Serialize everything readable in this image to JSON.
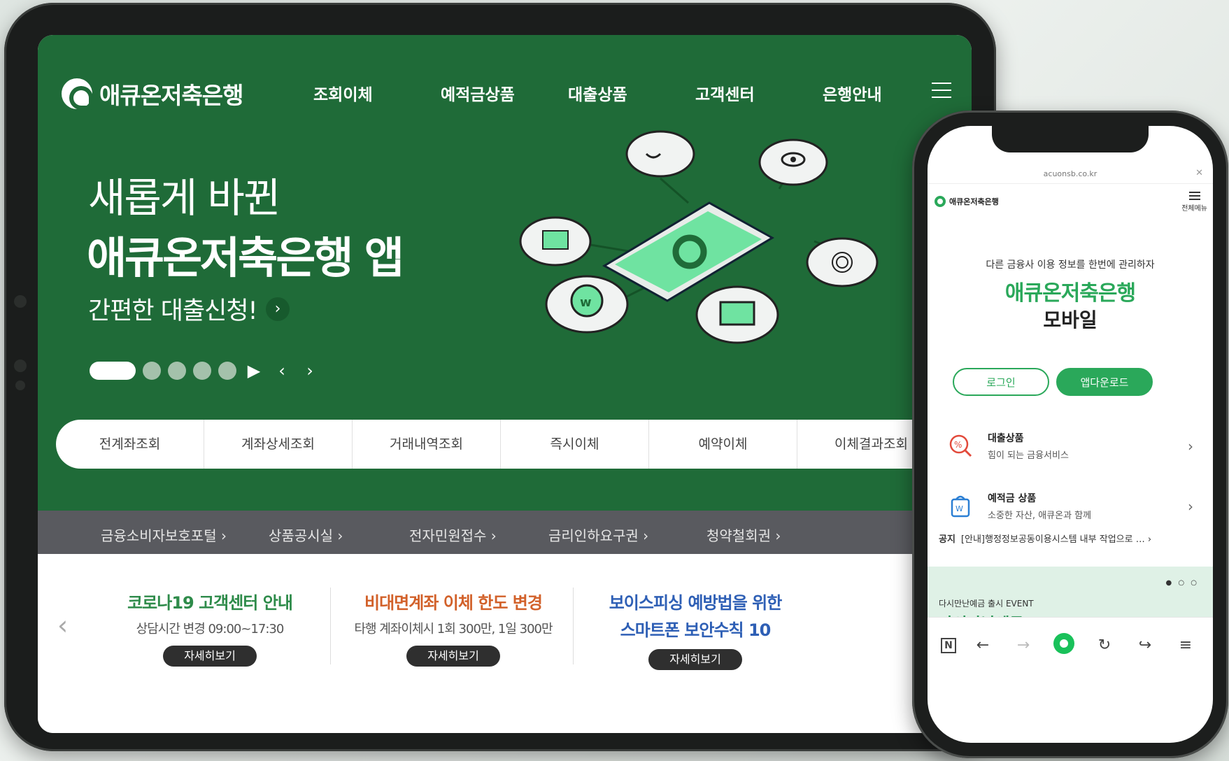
{
  "tablet": {
    "logo_text": "애큐온저축은행",
    "nav": [
      "조회이체",
      "예적금상품",
      "대출상품",
      "고객센터",
      "은행안내"
    ],
    "hero": {
      "line1": "새롭게 바뀐",
      "line2": "애큐온저축은행 앱",
      "sub": "간편한 대출신청!",
      "slides_total": 5,
      "slide_active": 1
    },
    "quick_menu": [
      "전계좌조회",
      "계좌상세조회",
      "거래내역조회",
      "즉시이체",
      "예약이체",
      "이체결과조회"
    ],
    "gray_links": [
      "금융소비자보호포털",
      "상품공시실",
      "전자민원접수",
      "금리인하요구권",
      "청약철회권"
    ],
    "notices": [
      {
        "title": "코로나19 고객센터 안내",
        "sub": "상담시간 변경 09:00~17:30",
        "btn": "자세히보기",
        "color": "#2e8b4a"
      },
      {
        "title": "비대면계좌 이체 한도 변경",
        "sub": "타행 계좌이체시 1회 300만, 1일 300만",
        "btn": "자세히보기",
        "color": "#d2612a"
      },
      {
        "title": "보이스피싱 예방법을 위한",
        "title2": "스마트폰 보안수칙 10",
        "btn": "자세히보기",
        "color": "#2e5fb5"
      }
    ]
  },
  "phone": {
    "url": "acuonsb.co.kr",
    "logo_text": "애큐온저축은행",
    "menu_label": "전체메뉴",
    "tagline": "다른 금융사 이용 정보를 한번에 관리하자",
    "title": "애큐온저축은행",
    "title2": "모바일",
    "login_btn": "로그인",
    "app_btn": "앱다운로드",
    "rows": [
      {
        "head": "대출상품",
        "desc": "힘이 되는 금융서비스"
      },
      {
        "head": "예적금 상품",
        "desc": "소중한 자산, 애큐온과 함께"
      }
    ],
    "notice_label": "공지",
    "notice_text": "[안내]행정정보공동이용시스템 내부 작업으로 …",
    "banner_small": "다시만난예금 출시 EVENT",
    "banner_big": "다시만난예금"
  },
  "colors": {
    "brand_green": "#1f6b38",
    "accent_green": "#2aa85a",
    "gray_bar": "#595a5f"
  }
}
